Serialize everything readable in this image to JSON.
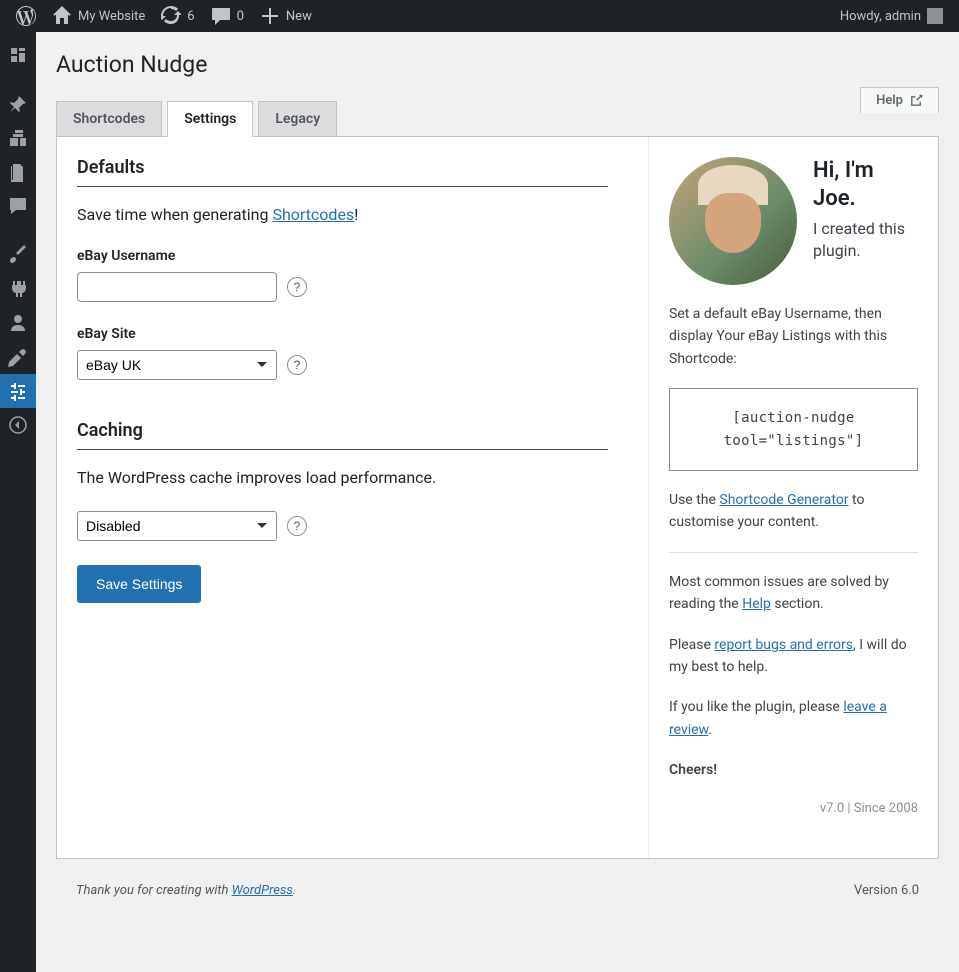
{
  "adminbar": {
    "site_name": "My Website",
    "updates_count": "6",
    "comments_count": "0",
    "new_label": "New",
    "howdy_text": "Howdy, admin"
  },
  "page": {
    "title": "Auction Nudge"
  },
  "tabs": {
    "shortcodes": "Shortcodes",
    "settings": "Settings",
    "legacy": "Legacy"
  },
  "help_tab": {
    "label": "Help"
  },
  "sections": {
    "defaults": {
      "heading": "Defaults",
      "desc_pre": "Save time when generating ",
      "desc_link": "Shortcodes",
      "desc_post": "!"
    },
    "caching": {
      "heading": "Caching",
      "desc": "The WordPress cache improves load performance."
    }
  },
  "fields": {
    "ebay_username": {
      "label": "eBay Username",
      "value": ""
    },
    "ebay_site": {
      "label": "eBay Site",
      "value": "eBay UK"
    },
    "cache": {
      "value": "Disabled"
    }
  },
  "buttons": {
    "save": "Save Settings",
    "help": "?"
  },
  "sidebar_box": {
    "greeting": "Hi, I'm Joe.",
    "created": "I created this plugin.",
    "p1": "Set a default eBay Username, then display Your eBay Listings with this Shortcode:",
    "code": "[auction-nudge tool=\"listings\"]",
    "p2_pre": "Use the ",
    "p2_link": "Shortcode Generator",
    "p2_post": " to customise your content.",
    "p3_pre": "Most common issues are solved by reading the ",
    "p3_link": "Help",
    "p3_post": " section.",
    "p4_pre": "Please ",
    "p4_link": "report bugs and errors",
    "p4_post": ", I will do my best to help.",
    "p5_pre": "If you like the plugin, please ",
    "p5_link": "leave a review",
    "p5_post": ".",
    "cheers": "Cheers!",
    "version": "v7.0 | Since 2008"
  },
  "footer": {
    "left_pre": "Thank you for creating with ",
    "left_link": "WordPress",
    "left_post": ".",
    "right": "Version 6.0"
  }
}
